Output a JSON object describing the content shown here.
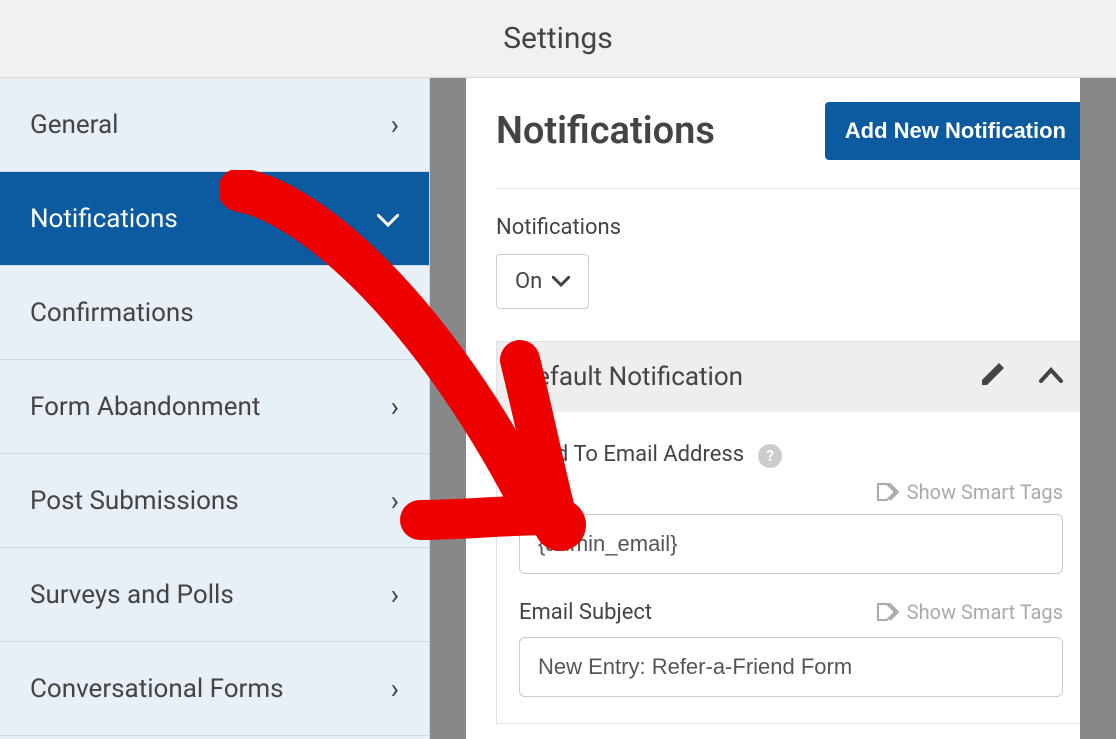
{
  "topbar": {
    "title": "Settings"
  },
  "sidebar": {
    "items": [
      {
        "label": "General"
      },
      {
        "label": "Notifications"
      },
      {
        "label": "Confirmations"
      },
      {
        "label": "Form Abandonment"
      },
      {
        "label": "Post Submissions"
      },
      {
        "label": "Surveys and Polls"
      },
      {
        "label": "Conversational Forms"
      }
    ]
  },
  "main": {
    "heading": "Notifications",
    "add_button": "Add New Notification",
    "toggle_label": "Notifications",
    "toggle_value": "On",
    "panel_title": "Default Notification",
    "send_to_label": "Send To Email Address",
    "smart_tags": "Show Smart Tags",
    "send_to_value": "{admin_email}",
    "subject_label": "Email Subject",
    "subject_value": "New Entry: Refer-a-Friend Form"
  }
}
